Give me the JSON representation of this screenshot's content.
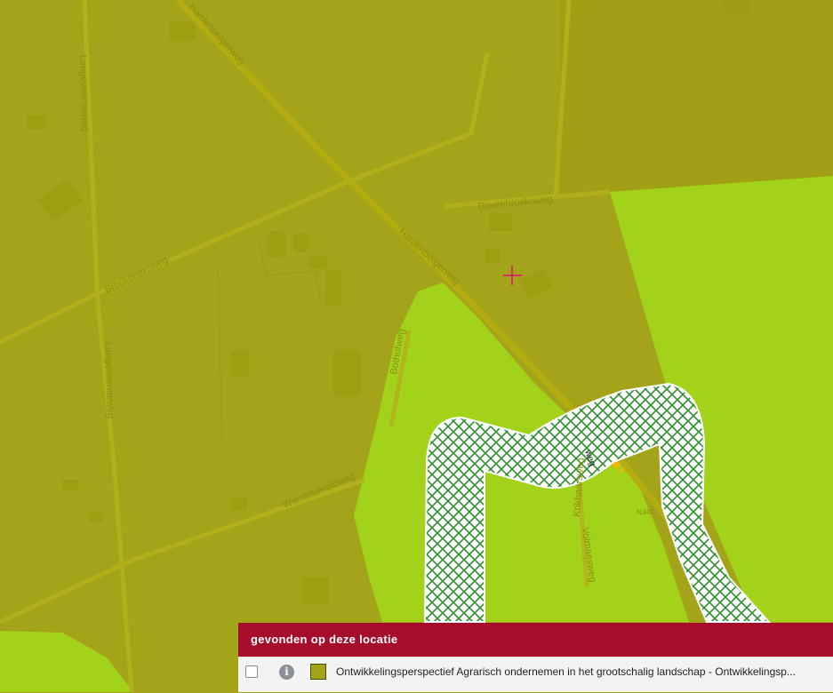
{
  "map": {
    "road_labels": {
      "hardenbergerweg_north": "Hardenbergerweg",
      "hardenbergerweg_middle": "Hardenbergerweg",
      "langeveenseweg_north": "Langeveenseweg",
      "langeveenseweg_south": "Langeveenseweg",
      "broekbeeksweg": "Broekbeeksweg",
      "bovenbroeksweg": "Bovenbroeksweg",
      "bothofweg": "Bothofweg",
      "wierensevelweg": "Wierenseveldweg",
      "krikhaarsweg": "Krikhaarsweg",
      "volmaesweg": "Volmaesweg",
      "n343": "N343",
      "weg": "weg"
    },
    "colors": {
      "agrarisch_zone": "#a4a41a",
      "green_zone": "#a3d21b",
      "hatch_green": "#2f8f2f",
      "road_major": "#f2b500"
    },
    "crosshair_icon": "crosshair-marker"
  },
  "panel": {
    "header": "gevonden op deze locatie",
    "rows": [
      {
        "checked": false,
        "info_icon": "info-circle-icon",
        "swatch_color": "#a4a41a",
        "label": "Ontwikkelingsperspectief Agrarisch ondernemen in het grootschalig landschap - Ontwikkelingsp..."
      }
    ]
  }
}
